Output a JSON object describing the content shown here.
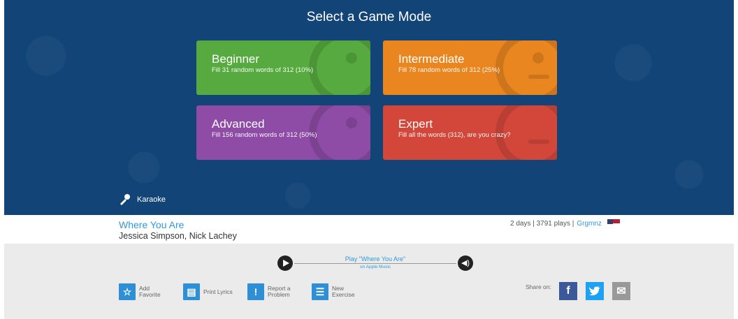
{
  "hero": {
    "title": "Select a Game Mode",
    "modes": [
      {
        "name": "Beginner",
        "desc": "Fill 31 random words of 312 (10%)",
        "color": "#57aa3f",
        "icon": "smile-face-icon"
      },
      {
        "name": "Intermediate",
        "desc": "Fill 78 random words of 312 (25%)",
        "color": "#e9861f",
        "icon": "neutral-face-icon"
      },
      {
        "name": "Advanced",
        "desc": "Fill 156 random words of 312 (50%)",
        "color": "#8e4ca6",
        "icon": "sad-face-icon"
      },
      {
        "name": "Expert",
        "desc": "Fill all the words (312), are you crazy?",
        "color": "#d3473b",
        "icon": "dead-face-icon"
      }
    ],
    "karaoke_label": "Karaoke",
    "background": "#124477"
  },
  "song": {
    "title": "Where You Are",
    "artist": "Jessica Simpson, Nick Lachey",
    "meta_text": "2 days | 3791 plays | ",
    "user": "Grgmnz"
  },
  "player": {
    "play_label": "Play \"Where You Are\"",
    "source_label": "on Apple Music"
  },
  "actions": [
    {
      "label": "Add Favorite",
      "icon": "star-icon"
    },
    {
      "label": "Print Lyrics",
      "icon": "printer-icon"
    },
    {
      "label": "Report a Problem",
      "icon": "exclamation-icon"
    },
    {
      "label": "New Exercise",
      "icon": "list-icon"
    }
  ],
  "share": {
    "label": "Share on:",
    "networks": [
      {
        "name": "facebook",
        "glyph": "f",
        "color": "#3b5998"
      },
      {
        "name": "twitter",
        "glyph": "t",
        "color": "#1da1f2"
      },
      {
        "name": "email",
        "glyph": "✉",
        "color": "#999999"
      }
    ]
  },
  "accent": "#2f9ad9"
}
